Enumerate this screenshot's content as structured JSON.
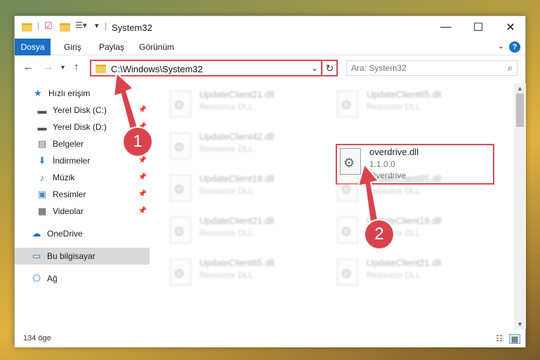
{
  "window": {
    "title": "System32"
  },
  "ribbon": {
    "tabs": [
      "Dosya",
      "Giriş",
      "Paylaş",
      "Görünüm"
    ],
    "help": "?"
  },
  "address": {
    "path": "C:\\Windows\\System32"
  },
  "search": {
    "placeholder": "Ara: System32"
  },
  "sidebar": {
    "items": [
      {
        "label": "Hızlı erişim",
        "icon": "star-icon",
        "pinned": false
      },
      {
        "label": "Yerel Disk (C:)",
        "icon": "drive-icon",
        "pinned": true
      },
      {
        "label": "Yerel Disk (D:)",
        "icon": "drive-icon",
        "pinned": true
      },
      {
        "label": "Belgeler",
        "icon": "document-icon",
        "pinned": true
      },
      {
        "label": "İndirmeler",
        "icon": "download-icon",
        "pinned": true
      },
      {
        "label": "Müzik",
        "icon": "music-icon",
        "pinned": true
      },
      {
        "label": "Resimler",
        "icon": "pictures-icon",
        "pinned": true
      },
      {
        "label": "Videolar",
        "icon": "video-icon",
        "pinned": true
      },
      {
        "label": "OneDrive",
        "icon": "cloud-icon",
        "pinned": false
      },
      {
        "label": "Bu bilgisayar",
        "icon": "computer-icon",
        "pinned": false
      },
      {
        "label": "Ağ",
        "icon": "network-icon",
        "pinned": false
      }
    ]
  },
  "files": [
    {
      "name": "UpdateClient21.dll",
      "type": "Resource DLL"
    },
    {
      "name": "UpdateClient65.dll",
      "type": "Resource DLL"
    },
    {
      "name": "UpdateClient42.dll",
      "type": "Resource DLL"
    },
    {
      "name": "overdrive.dll",
      "version": "1.1.0.0",
      "company": "Overdrive"
    },
    {
      "name": "UpdateClient19.dll",
      "type": "Resource DLL"
    },
    {
      "name": "UpdateClient65.dll",
      "type": "Resource DLL"
    },
    {
      "name": "UpdateClient21.dll",
      "type": "Resource DLL"
    },
    {
      "name": "UpdateClient19.dll",
      "type": "Resource DLL"
    },
    {
      "name": "UpdateClient65.dll",
      "type": "Resource DLL"
    },
    {
      "name": "UpdateClient21.dll",
      "type": "Resource DLL"
    }
  ],
  "status": {
    "count": "134 öge"
  },
  "annotations": {
    "step1": "1",
    "step2": "2"
  },
  "colors": {
    "accent": "#1a6fc4",
    "highlight": "#d94a55"
  }
}
